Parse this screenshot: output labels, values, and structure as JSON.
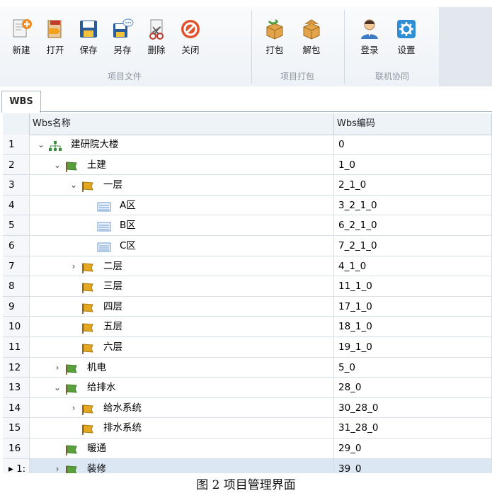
{
  "ribbon": {
    "groups": [
      {
        "title": "项目文件",
        "buttons": [
          {
            "label": "新建",
            "icon": "new-file-icon"
          },
          {
            "label": "打开",
            "icon": "open-folder-icon"
          },
          {
            "label": "保存",
            "icon": "save-icon"
          },
          {
            "label": "另存",
            "icon": "save-as-icon"
          },
          {
            "label": "删除",
            "icon": "delete-icon"
          },
          {
            "label": "关闭",
            "icon": "close-icon"
          }
        ]
      },
      {
        "title": "项目打包",
        "buttons": [
          {
            "label": "打包",
            "icon": "package-icon"
          },
          {
            "label": "解包",
            "icon": "unpackage-icon"
          }
        ]
      },
      {
        "title": "联机协同",
        "buttons": [
          {
            "label": "登录",
            "icon": "user-login-icon"
          },
          {
            "label": "设置",
            "icon": "settings-icon"
          }
        ]
      }
    ]
  },
  "tab": {
    "label": "WBS"
  },
  "grid": {
    "columns": {
      "name": "Wbs名称",
      "code": "Wbs编码"
    },
    "rows": [
      {
        "num": "1",
        "name": "建研院大楼",
        "code": "0",
        "indent": 0,
        "toggle": "⌄",
        "icon": "org-chart-icon"
      },
      {
        "num": "2",
        "name": "土建",
        "code": "1_0",
        "indent": 1,
        "toggle": "⌄",
        "icon": "flag-green-icon"
      },
      {
        "num": "3",
        "name": "一层",
        "code": "2_1_0",
        "indent": 2,
        "toggle": "⌄",
        "icon": "flag-yellow-icon"
      },
      {
        "num": "4",
        "name": "A区",
        "code": "3_2_1_0",
        "indent": 3,
        "toggle": "",
        "icon": "list-item-icon"
      },
      {
        "num": "5",
        "name": "B区",
        "code": "6_2_1_0",
        "indent": 3,
        "toggle": "",
        "icon": "list-item-icon"
      },
      {
        "num": "6",
        "name": "C区",
        "code": "7_2_1_0",
        "indent": 3,
        "toggle": "",
        "icon": "list-item-icon"
      },
      {
        "num": "7",
        "name": "二层",
        "code": "4_1_0",
        "indent": 2,
        "toggle": "›",
        "icon": "flag-yellow-icon"
      },
      {
        "num": "8",
        "name": "三层",
        "code": "11_1_0",
        "indent": 2,
        "toggle": "",
        "icon": "flag-yellow-icon"
      },
      {
        "num": "9",
        "name": "四层",
        "code": "17_1_0",
        "indent": 2,
        "toggle": "",
        "icon": "flag-yellow-icon"
      },
      {
        "num": "10",
        "name": "五层",
        "code": "18_1_0",
        "indent": 2,
        "toggle": "",
        "icon": "flag-yellow-icon"
      },
      {
        "num": "11",
        "name": "六层",
        "code": "19_1_0",
        "indent": 2,
        "toggle": "",
        "icon": "flag-yellow-icon"
      },
      {
        "num": "12",
        "name": "机电",
        "code": "5_0",
        "indent": 1,
        "toggle": "›",
        "icon": "flag-green-icon"
      },
      {
        "num": "13",
        "name": "给排水",
        "code": "28_0",
        "indent": 1,
        "toggle": "⌄",
        "icon": "flag-green-icon"
      },
      {
        "num": "14",
        "name": "给水系统",
        "code": "30_28_0",
        "indent": 2,
        "toggle": "›",
        "icon": "flag-yellow-icon"
      },
      {
        "num": "15",
        "name": "排水系统",
        "code": "31_28_0",
        "indent": 2,
        "toggle": "",
        "icon": "flag-yellow-icon"
      },
      {
        "num": "16",
        "name": "暖通",
        "code": "29_0",
        "indent": 1,
        "toggle": "",
        "icon": "flag-green-icon"
      },
      {
        "num": "▸ 1:",
        "name": "装修",
        "code": "39_0",
        "indent": 1,
        "toggle": "›",
        "icon": "flag-green-icon",
        "selected": true
      }
    ]
  },
  "caption": "图 2  项目管理界面",
  "colors": {
    "flag_green": "#5aa03c",
    "flag_yellow": "#e3a81f",
    "list_blue": "#6c9bd1",
    "selection": "#dbe7f3"
  }
}
